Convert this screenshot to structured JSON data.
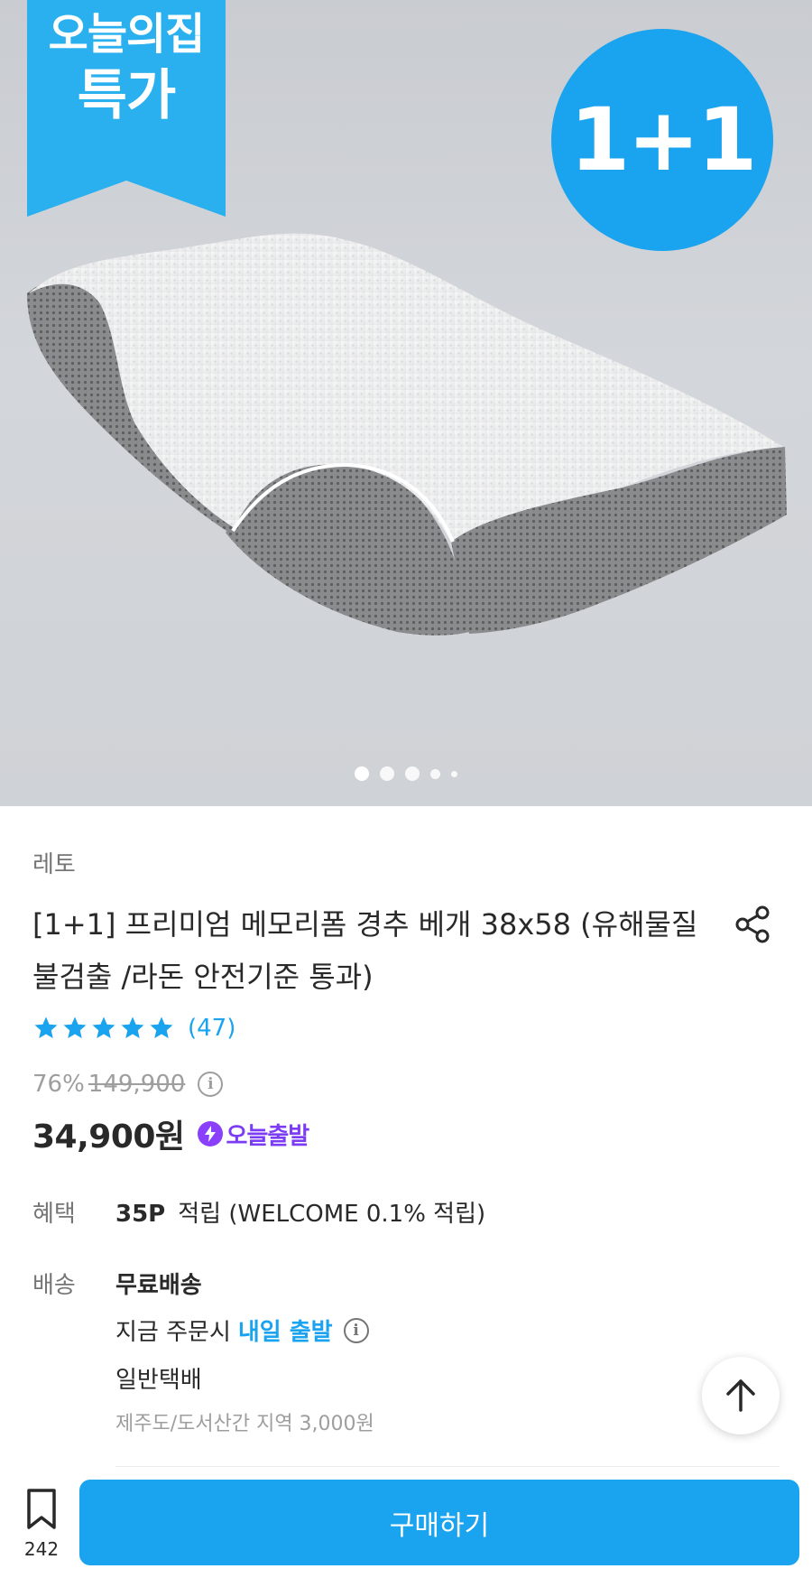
{
  "hero": {
    "ribbon_line1": "오늘의집",
    "ribbon_line2": "특가",
    "badge_text": "1+1",
    "carousel_dots": 5,
    "carousel_active_index": 0
  },
  "product": {
    "brand": "레토",
    "title": "[1+1] 프리미엄 메모리폼 경추 베개 38x58 (유해물질 불검출 /라돈 안전기준 통과)",
    "rating_stars": 5,
    "review_count": "(47)",
    "discount": "76%",
    "original_price": "149,900",
    "price": "34,900원",
    "today_ship_badge": "오늘출발"
  },
  "benefit": {
    "label": "혜택",
    "points": "35P",
    "text": "적립 (WELCOME 0.1% 적립)"
  },
  "shipping": {
    "label": "배송",
    "title": "무료배송",
    "order_prefix": "지금 주문시",
    "order_highlight": "내일 출발",
    "type": "일반택배",
    "extra": "제주도/도서산간 지역 3,000원"
  },
  "bottom_bar": {
    "bookmark_count": "242",
    "buy_label": "구매하기"
  },
  "colors": {
    "accent": "#1aa3ee",
    "today_ship": "#7b3cf3",
    "text": "#292929",
    "muted": "#757575"
  },
  "icons": {
    "share": "share-icon",
    "info": "info-icon",
    "scroll_top": "arrow-up-icon",
    "bookmark": "bookmark-icon",
    "bolt": "lightning-icon",
    "star": "star-icon"
  }
}
